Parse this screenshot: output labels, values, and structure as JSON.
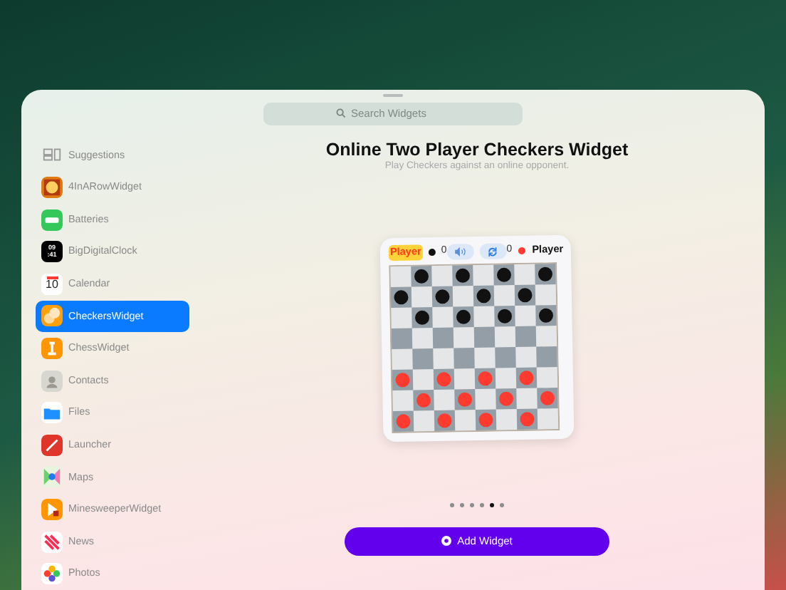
{
  "search": {
    "placeholder": "Search Widgets"
  },
  "sidebar": {
    "items": [
      {
        "label": "Suggestions",
        "kind": "suggestions",
        "selected": false
      },
      {
        "label": "4InARowWidget",
        "kind": "fourinarow",
        "selected": false
      },
      {
        "label": "Batteries",
        "kind": "batteries",
        "selected": false
      },
      {
        "label": "BigDigitalClock",
        "kind": "clock",
        "icon_text": [
          "09",
          ":41"
        ],
        "selected": false
      },
      {
        "label": "Calendar",
        "kind": "calendar",
        "icon_text": [
          "10"
        ],
        "selected": false
      },
      {
        "label": "CheckersWidget",
        "kind": "checkers",
        "selected": true
      },
      {
        "label": "ChessWidget",
        "kind": "chess",
        "selected": false
      },
      {
        "label": "Contacts",
        "kind": "contacts",
        "selected": false
      },
      {
        "label": "Files",
        "kind": "files",
        "selected": false
      },
      {
        "label": "Launcher",
        "kind": "launcher",
        "selected": false
      },
      {
        "label": "Maps",
        "kind": "maps",
        "selected": false
      },
      {
        "label": "MinesweeperWidget",
        "kind": "minesweeper",
        "selected": false
      },
      {
        "label": "News",
        "kind": "news",
        "selected": false
      },
      {
        "label": "Photos",
        "kind": "photos",
        "selected": false
      }
    ]
  },
  "detail": {
    "title": "Online Two Player Checkers Widget",
    "subtitle": "Play Checkers against an online opponent.",
    "widget": {
      "left_player": {
        "name": "Player",
        "score": "0",
        "color": "#111111",
        "turn": true
      },
      "right_player": {
        "name": "Player",
        "score": "0",
        "color": "#ff3b30",
        "turn": false
      },
      "board": [
        [
          {
            "kind": "empty"
          },
          {
            "kind": "dark"
          },
          {
            "kind": "empty"
          },
          {
            "kind": "dark"
          },
          {
            "kind": "empty"
          },
          {
            "kind": "dark"
          },
          {
            "kind": "empty"
          },
          {
            "kind": "dark"
          }
        ],
        [
          {
            "kind": "dark"
          },
          {
            "kind": "empty"
          },
          {
            "kind": "dark"
          },
          {
            "kind": "empty"
          },
          {
            "kind": "dark"
          },
          {
            "kind": "empty"
          },
          {
            "kind": "dark"
          },
          {
            "kind": "empty"
          }
        ],
        [
          {
            "kind": "empty"
          },
          {
            "kind": "dark"
          },
          {
            "kind": "empty"
          },
          {
            "kind": "dark"
          },
          {
            "kind": "empty"
          },
          {
            "kind": "dark"
          },
          {
            "kind": "empty"
          },
          {
            "kind": "dark"
          }
        ],
        [
          {
            "kind": "empty"
          },
          {
            "kind": "empty"
          },
          {
            "kind": "empty"
          },
          {
            "kind": "empty"
          },
          {
            "kind": "empty"
          },
          {
            "kind": "empty"
          },
          {
            "kind": "empty"
          },
          {
            "kind": "empty"
          }
        ],
        [
          {
            "kind": "empty"
          },
          {
            "kind": "empty"
          },
          {
            "kind": "empty"
          },
          {
            "kind": "empty"
          },
          {
            "kind": "empty"
          },
          {
            "kind": "empty"
          },
          {
            "kind": "empty"
          },
          {
            "kind": "empty"
          }
        ],
        [
          {
            "kind": "light"
          },
          {
            "kind": "empty"
          },
          {
            "kind": "light"
          },
          {
            "kind": "empty"
          },
          {
            "kind": "light"
          },
          {
            "kind": "empty"
          },
          {
            "kind": "light"
          },
          {
            "kind": "empty"
          }
        ],
        [
          {
            "kind": "empty"
          },
          {
            "kind": "light"
          },
          {
            "kind": "empty"
          },
          {
            "kind": "light"
          },
          {
            "kind": "empty"
          },
          {
            "kind": "light"
          },
          {
            "kind": "empty"
          },
          {
            "kind": "light"
          }
        ],
        [
          {
            "kind": "light"
          },
          {
            "kind": "empty"
          },
          {
            "kind": "light"
          },
          {
            "kind": "empty"
          },
          {
            "kind": "light"
          },
          {
            "kind": "empty"
          },
          {
            "kind": "light"
          },
          {
            "kind": "empty"
          }
        ]
      ]
    },
    "pages": [
      {
        "selected": false
      },
      {
        "selected": false
      },
      {
        "selected": false
      },
      {
        "selected": false
      },
      {
        "selected": true
      },
      {
        "selected": false
      }
    ],
    "add_button": "Add Widget"
  }
}
